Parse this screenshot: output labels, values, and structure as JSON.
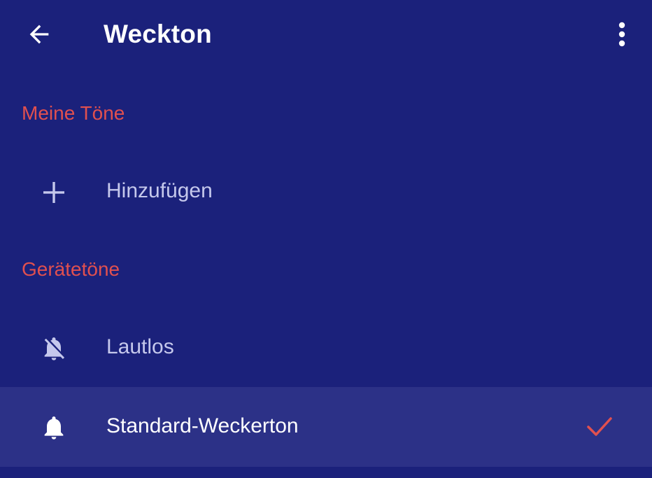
{
  "app_bar": {
    "title": "Weckton",
    "back_icon": "arrow-back-icon",
    "menu_icon": "more-vert-icon"
  },
  "sections": {
    "my_tones": {
      "header": "Meine Töne",
      "items": [
        {
          "label": "Hinzufügen",
          "icon": "plus-icon"
        }
      ]
    },
    "device_tones": {
      "header": "Gerätetöne",
      "items": [
        {
          "label": "Lautlos",
          "icon": "bell-off-icon",
          "selected": false
        },
        {
          "label": "Standard-Weckerton",
          "icon": "bell-icon",
          "selected": true
        }
      ]
    }
  },
  "colors": {
    "background": "#1b217b",
    "selected_row": "#2c3187",
    "accent": "#e1504f",
    "title_text": "#ffffff",
    "item_text": "#c5c8ec"
  }
}
